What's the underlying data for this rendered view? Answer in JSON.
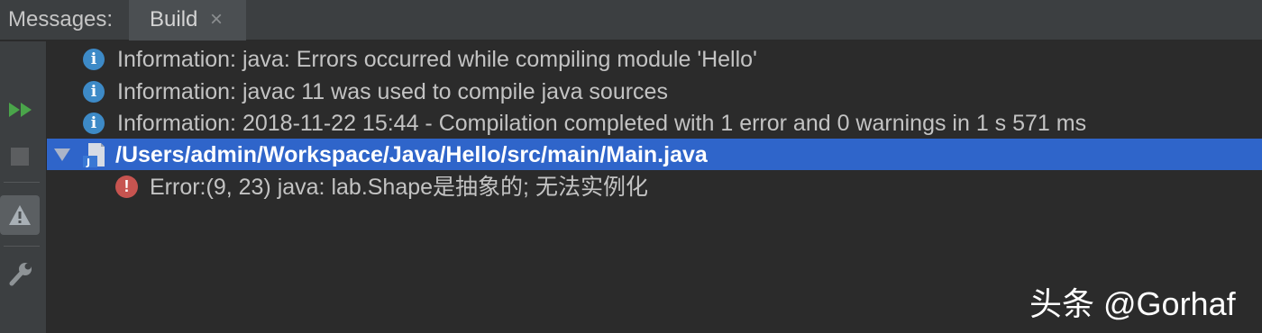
{
  "header": {
    "title": "Messages:",
    "tabs": [
      {
        "label": "Build",
        "close": "×"
      }
    ]
  },
  "toolbar": {
    "buttons": [
      "rerun-icon",
      "stop-icon",
      "warning-icon",
      "wrench-icon"
    ],
    "colors": {
      "rerun": "#4aa54a",
      "stop": "#5c5e60"
    }
  },
  "messages": [
    {
      "type": "info",
      "icon": "info-icon",
      "text": "Information: java: Errors occurred while compiling module 'Hello'"
    },
    {
      "type": "info",
      "icon": "info-icon",
      "text": "Information: javac 11 was used to compile java sources"
    },
    {
      "type": "info",
      "icon": "info-icon",
      "text": "Information: 2018-11-22 15:44 - Compilation completed with 1 error and 0 warnings in 1 s 571 ms"
    }
  ],
  "file_node": {
    "path": "/Users/admin/Workspace/Java/Hello/src/main/Main.java",
    "icon": "java-file-icon",
    "expanded": true,
    "selected": true
  },
  "error": {
    "icon": "error-icon",
    "icon_glyph": "!",
    "text": "Error:(9, 23)  java: lab.Shape是抽象的; 无法实例化"
  },
  "info_glyph": "i",
  "watermark": "头条 @Gorhaf",
  "colors": {
    "background": "#2b2b2b",
    "panel": "#3c3f41",
    "selection": "#2f65ca",
    "info": "#3d8ac7",
    "error": "#c75450"
  }
}
